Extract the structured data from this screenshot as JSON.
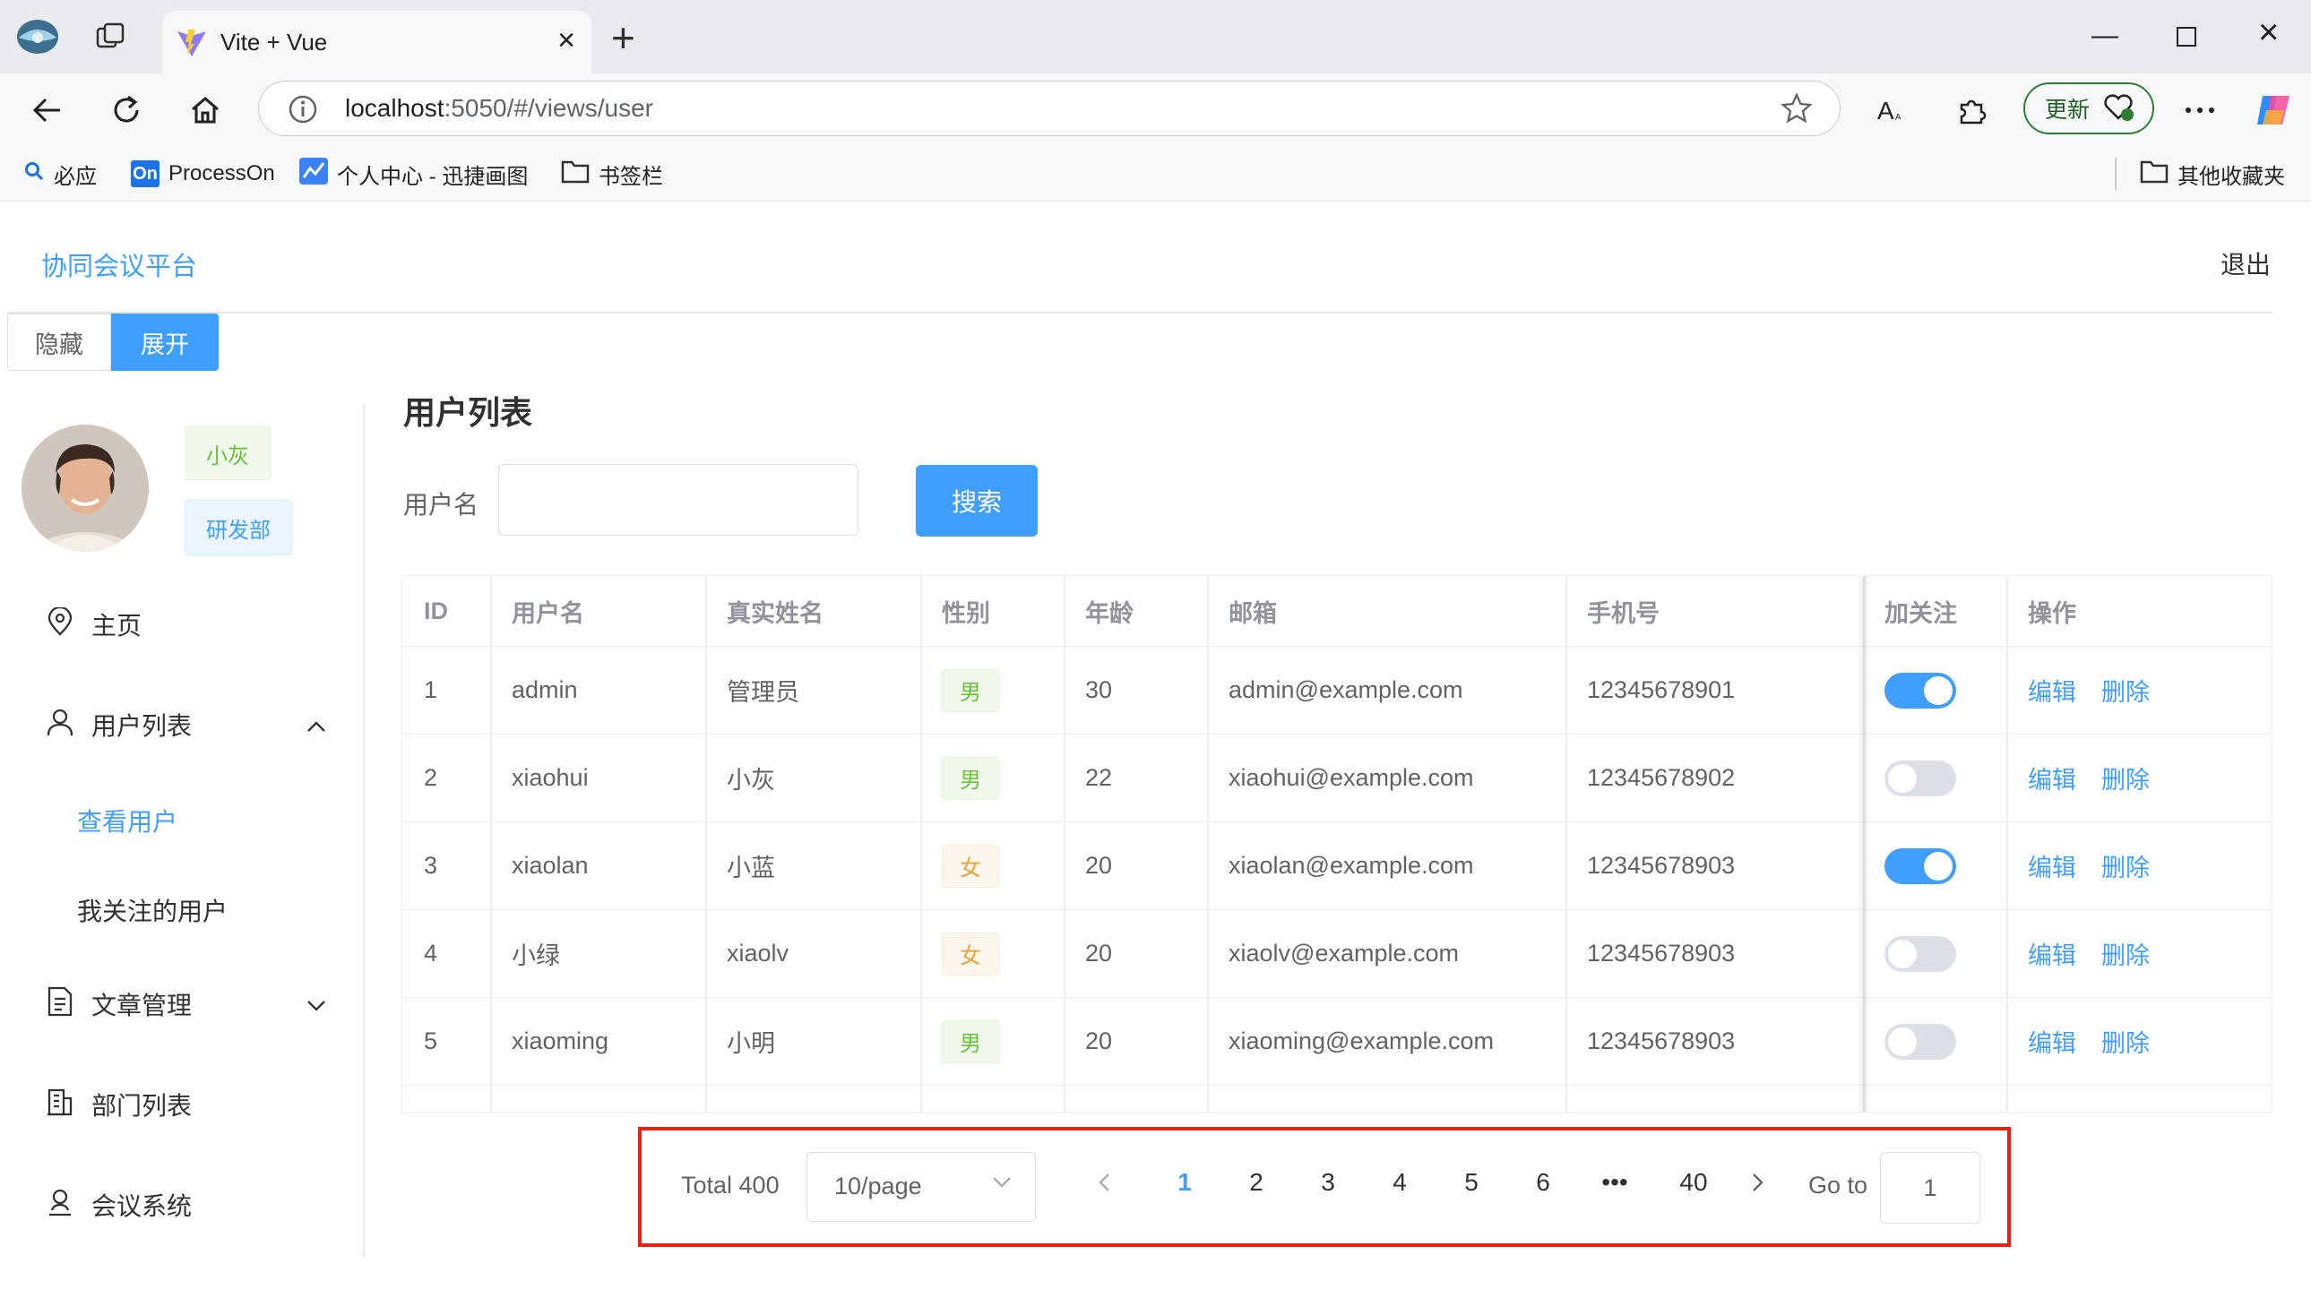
{
  "browser": {
    "tab_title": "Vite + Vue",
    "url_host": "localhost",
    "url_rest": ":5050/#/views/user",
    "update_label": "更新",
    "bookmarks": [
      "必应",
      "ProcessOn",
      "个人中心 - 迅捷画图",
      "书签栏"
    ],
    "other_bookmarks": "其他收藏夹"
  },
  "app": {
    "brand": "协同会议平台",
    "logout": "退出",
    "hide_label": "隐藏",
    "expand_label": "展开"
  },
  "user_card": {
    "name_tag": "小灰",
    "dept_tag": "研发部"
  },
  "menu": {
    "home": "主页",
    "user_list": "用户列表",
    "view_users": "查看用户",
    "followed_users": "我关注的用户",
    "articles": "文章管理",
    "departments": "部门列表",
    "meetings": "会议系统"
  },
  "main": {
    "title": "用户列表",
    "search_label": "用户名",
    "search_placeholder": "",
    "search_button": "搜索"
  },
  "table": {
    "headers": [
      "ID",
      "用户名",
      "真实姓名",
      "性别",
      "年龄",
      "邮箱",
      "手机号",
      "加关注",
      "操作"
    ],
    "rows": [
      {
        "id": "1",
        "username": "admin",
        "realname": "管理员",
        "gender": "男",
        "age": "30",
        "email": "admin@example.com",
        "phone": "12345678901",
        "follow": true,
        "edit": "编辑",
        "delete": "删除"
      },
      {
        "id": "2",
        "username": "xiaohui",
        "realname": "小灰",
        "gender": "男",
        "age": "22",
        "email": "xiaohui@example.com",
        "phone": "12345678902",
        "follow": false,
        "edit": "编辑",
        "delete": "删除"
      },
      {
        "id": "3",
        "username": "xiaolan",
        "realname": "小蓝",
        "gender": "女",
        "age": "20",
        "email": "xiaolan@example.com",
        "phone": "12345678903",
        "follow": true,
        "edit": "编辑",
        "delete": "删除"
      },
      {
        "id": "4",
        "username": "小绿",
        "realname": "xiaolv",
        "gender": "女",
        "age": "20",
        "email": "xiaolv@example.com",
        "phone": "12345678903",
        "follow": false,
        "edit": "编辑",
        "delete": "删除"
      },
      {
        "id": "5",
        "username": "xiaoming",
        "realname": "小明",
        "gender": "男",
        "age": "20",
        "email": "xiaoming@example.com",
        "phone": "12345678903",
        "follow": false,
        "edit": "编辑",
        "delete": "删除"
      }
    ]
  },
  "pagination": {
    "total": "Total 400",
    "page_size": "10/page",
    "pages": [
      "1",
      "2",
      "3",
      "4",
      "5",
      "6",
      "•••",
      "40"
    ],
    "current": "1",
    "goto_label": "Go to",
    "goto_value": "1"
  },
  "colors": {
    "primary": "#409eff",
    "success": "#67c23a",
    "warning": "#e6a23c",
    "highlight_border": "#e8201a"
  }
}
